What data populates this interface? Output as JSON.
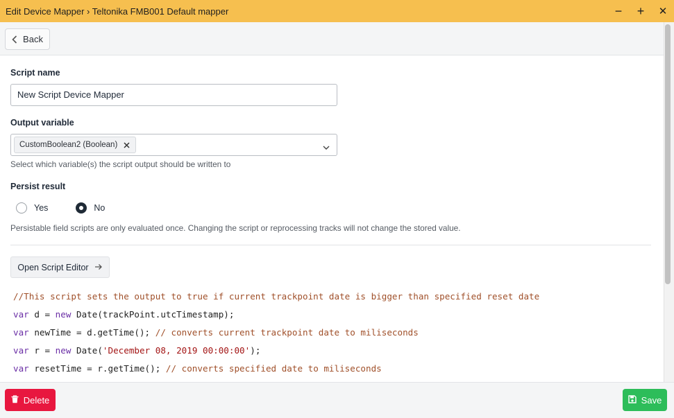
{
  "window": {
    "title": "Edit Device Mapper › Teltonika FMB001 Default mapper",
    "minimize_symbol": "−",
    "maximize_symbol": "+",
    "close_symbol": "✕",
    "accent_color": "#f6bf4f"
  },
  "toolbar": {
    "back_label": "Back"
  },
  "form": {
    "script_name_label": "Script name",
    "script_name_value": "New Script Device Mapper",
    "output_variable_label": "Output variable",
    "output_variable_selected": "CustomBoolean2 (Boolean)",
    "output_variable_help": "Select which variable(s) the script output should be written to",
    "persist_label": "Persist result",
    "persist_options": [
      {
        "label": "Yes",
        "checked": false
      },
      {
        "label": "No",
        "checked": true
      }
    ],
    "persist_help": "Persistable field scripts are only evaluated once. Changing the script or reprocessing tracks will not change the stored value.",
    "open_editor_label": "Open Script Editor"
  },
  "code": {
    "line1_comment": "//This script sets the output to true if current trackpoint date is bigger than specified reset date",
    "line2": {
      "kw1": "var",
      "mid1": " d = ",
      "kw2": "new",
      "rest": " Date(trackPoint.utcTimestamp);"
    },
    "line3": {
      "kw1": "var",
      "code": " newTime = d.getTime(); ",
      "comment": "// converts current trackpoint date to miliseconds"
    },
    "line4": {
      "kw1": "var",
      "mid1": " r = ",
      "kw2": "new",
      "mid2": " Date(",
      "str": "'December 08, 2019 00:00:00'",
      "rest": ");"
    },
    "line5": {
      "kw1": "var",
      "code": " resetTime = r.getTime(); ",
      "comment": "// converts specified date to miliseconds"
    }
  },
  "footer": {
    "delete_label": "Delete",
    "save_label": "Save",
    "delete_color": "#e8173f",
    "save_color": "#2dbd5a"
  }
}
